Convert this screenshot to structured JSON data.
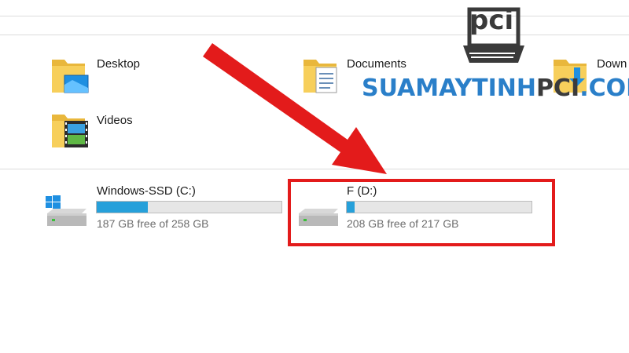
{
  "folders": [
    {
      "label": "Desktop",
      "icon": "desktop-folder-icon"
    },
    {
      "label": "Documents",
      "icon": "documents-folder-icon"
    },
    {
      "label": "Down",
      "icon": "downloads-folder-icon"
    },
    {
      "label": "Videos",
      "icon": "videos-folder-icon"
    }
  ],
  "drives": [
    {
      "label": "Windows-SSD (C:)",
      "free_text": "187 GB free of 258 GB",
      "used_fraction": 0.275,
      "icon": "windows-drive-icon"
    },
    {
      "label": "F (D:)",
      "free_text": "208 GB free of 217 GB",
      "used_fraction": 0.041,
      "icon": "hard-drive-icon"
    }
  ],
  "annotation": {
    "arrow_color": "#e31b1b",
    "frame_color": "#e31b1b"
  },
  "watermark": {
    "logo_text": "pci",
    "part1": "SUAMAYTINH",
    "part2": "PCI",
    "part3": ".COM"
  },
  "colors": {
    "progress_fill": "#26a0da",
    "progress_track": "#e6e6e6",
    "folder_yellow": "#f7cf5b"
  }
}
